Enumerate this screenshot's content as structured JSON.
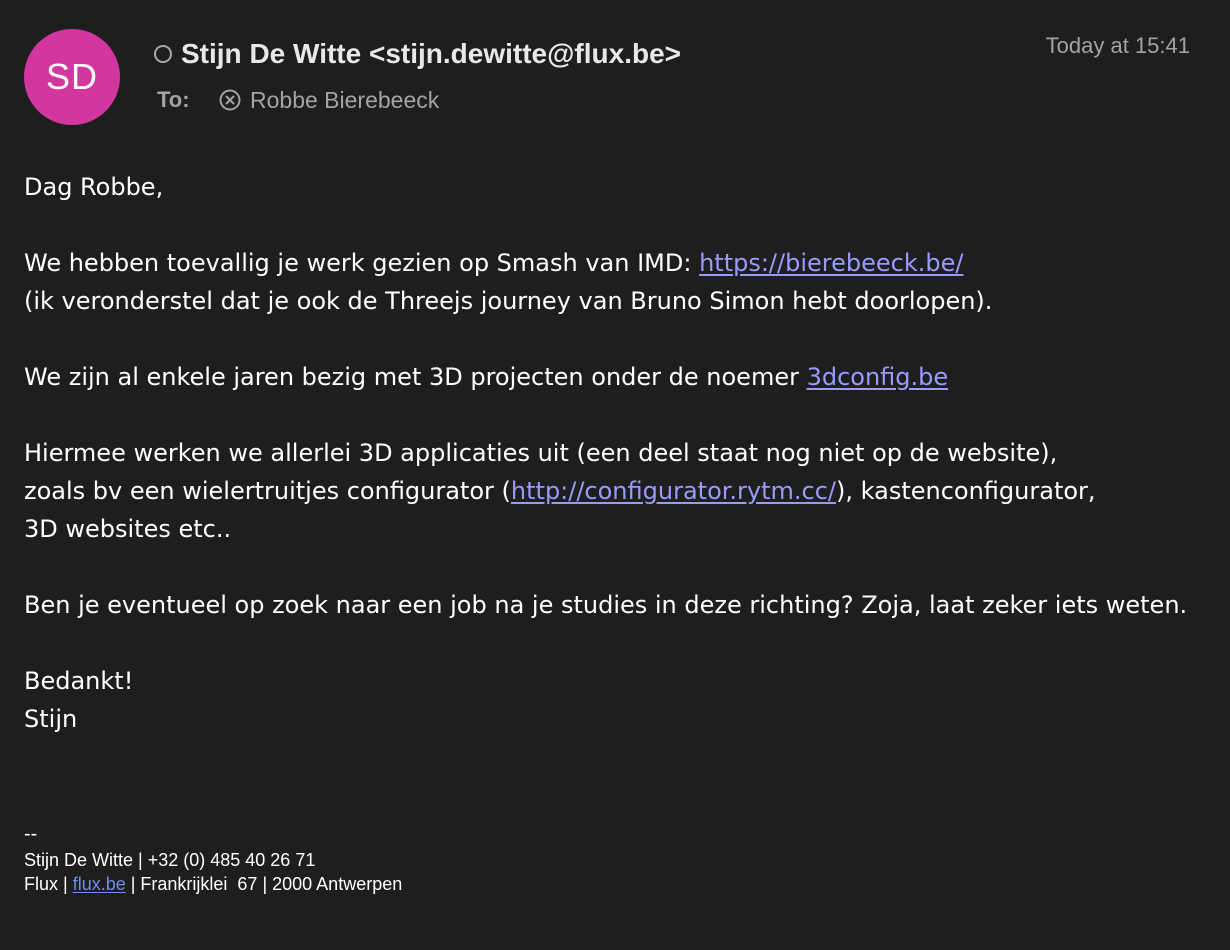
{
  "header": {
    "avatar_initials": "SD",
    "avatar_color": "#d3379f",
    "status_icon": "circle-status-icon",
    "sender": "Stijn De Witte <stijn.dewitte@flux.be>",
    "timestamp": "Today at 15:41",
    "to_label": "To:",
    "recipient_icon": "remove-circle-x-icon",
    "recipient": "Robbe Bierebeeck"
  },
  "body": {
    "greeting": "Dag Robbe,",
    "p1_text": "We hebben toevallig je werk gezien op Smash van IMD: ",
    "p1_link": "https://bierebeeck.be/",
    "p1_line2": "(ik veronderstel dat je ook de Threejs journey van Bruno Simon hebt doorlopen).",
    "p2_text": "We zijn al enkele jaren bezig met 3D projecten onder de noemer ",
    "p2_link": "3dconfig.be",
    "p3_line1": "Hiermee werken we allerlei 3D applicaties uit (een deel staat nog niet op de website),",
    "p3_pre": "zoals bv een wielertruitjes configurator (",
    "p3_link": "http://configurator.rytm.cc/",
    "p3_post": "), kastenconfigurator,",
    "p3_line3": "3D websites etc..",
    "p4": "Ben je eventueel op zoek naar een job na je studies in deze richting? Zoja, laat zeker iets weten.",
    "closing": "Bedankt!",
    "sign_name": "Stijn"
  },
  "signature": {
    "separator": "--",
    "line1": "Stijn De Witte | +32 (0) 485 40 26 71",
    "line2_pre": "Flux | ",
    "line2_link": "flux.be",
    "line2_post": " | Frankrijklei  67 | 2000 Antwerpen"
  },
  "colors": {
    "background": "#1e1e1e",
    "link": "#9a9aff",
    "signature_link": "#6f8ee8",
    "muted_text": "#a3a3a3"
  }
}
